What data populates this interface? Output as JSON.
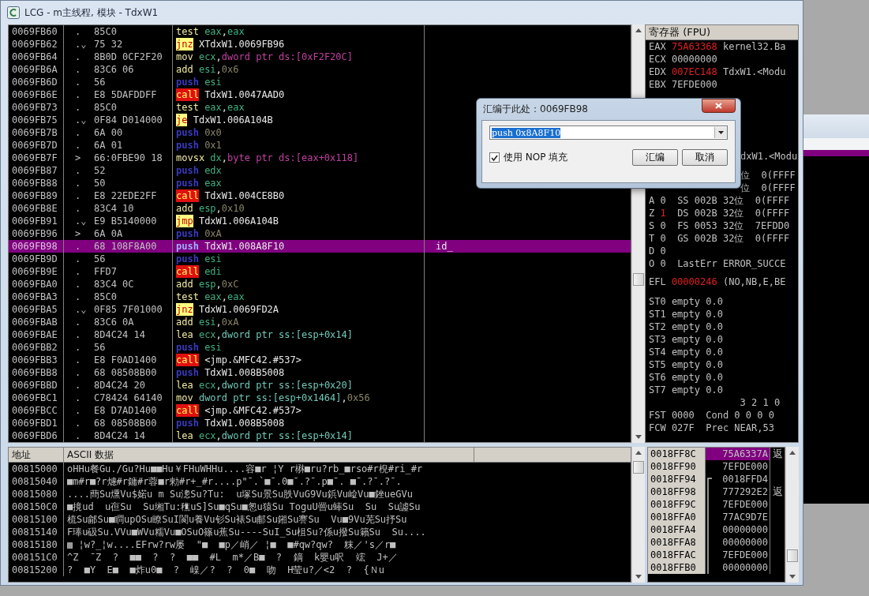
{
  "window": {
    "title": "LCG - m主线程, 模块 - TdxW1"
  },
  "disassembly": {
    "rows": [
      {
        "address": "0069FB60",
        "mark": ".",
        "hex": "85C0",
        "mnemonic": "test",
        "kind": "plain",
        "operands": [
          {
            "text": "eax",
            "kind": "reg"
          },
          {
            "text": ",",
            "kind": "punct"
          },
          {
            "text": "eax",
            "kind": "reg"
          }
        ],
        "selected": false
      },
      {
        "address": "0069FB62",
        "mark": ".⌄",
        "hex": "75 32",
        "mnemonic": "jnz",
        "kind": "jump",
        "operands": [
          {
            "text": "XTdxW1.0069FB96",
            "kind": "label"
          }
        ],
        "selected": false
      },
      {
        "address": "0069FB64",
        "mark": ".",
        "hex": "8B0D 0CF2F20",
        "mnemonic": "mov",
        "kind": "plain",
        "operands": [
          {
            "text": "ecx",
            "kind": "reg"
          },
          {
            "text": ",",
            "kind": "punct"
          },
          {
            "text": "dword ptr ds:[0xF2F20C]",
            "kind": "mem"
          }
        ],
        "selected": false
      },
      {
        "address": "0069FB6A",
        "mark": ".",
        "hex": "83C6 06",
        "mnemonic": "add",
        "kind": "plain",
        "operands": [
          {
            "text": "esi",
            "kind": "reg"
          },
          {
            "text": ",",
            "kind": "punct"
          },
          {
            "text": "0x6",
            "kind": "const"
          }
        ],
        "selected": false
      },
      {
        "address": "0069FB6D",
        "mark": ".",
        "hex": "56",
        "mnemonic": "push",
        "kind": "push",
        "operands": [
          {
            "text": "esi",
            "kind": "reg"
          }
        ],
        "selected": false
      },
      {
        "address": "0069FB6E",
        "mark": ".",
        "hex": "E8 5DAFDDFF",
        "mnemonic": "call",
        "kind": "call",
        "operands": [
          {
            "text": "TdxW1.0047AAD0",
            "kind": "label"
          }
        ],
        "selected": false
      },
      {
        "address": "0069FB73",
        "mark": ".",
        "hex": "85C0",
        "mnemonic": "test",
        "kind": "plain",
        "operands": [
          {
            "text": "eax",
            "kind": "reg"
          },
          {
            "text": ",",
            "kind": "punct"
          },
          {
            "text": "eax",
            "kind": "reg"
          }
        ],
        "selected": false
      },
      {
        "address": "0069FB75",
        "mark": ".⌄",
        "hex": "0F84 D014000",
        "mnemonic": "je",
        "kind": "jump",
        "operands": [
          {
            "text": "TdxW1.006A104B",
            "kind": "label"
          }
        ],
        "selected": false
      },
      {
        "address": "0069FB7B",
        "mark": ".",
        "hex": "6A 00",
        "mnemonic": "push",
        "kind": "push",
        "operands": [
          {
            "text": "0x0",
            "kind": "const"
          }
        ],
        "selected": false
      },
      {
        "address": "0069FB7D",
        "mark": ".",
        "hex": "6A 01",
        "mnemonic": "push",
        "kind": "push",
        "operands": [
          {
            "text": "0x1",
            "kind": "const"
          }
        ],
        "selected": false
      },
      {
        "address": "0069FB7F",
        "mark": ">",
        "hex": "66:0FBE90 18",
        "mnemonic": "movsx",
        "kind": "plain",
        "operands": [
          {
            "text": "dx",
            "kind": "reg"
          },
          {
            "text": ",",
            "kind": "punct"
          },
          {
            "text": "byte ptr ds:[eax+0x118]",
            "kind": "mem"
          }
        ],
        "selected": false
      },
      {
        "address": "0069FB87",
        "mark": ".",
        "hex": "52",
        "mnemonic": "push",
        "kind": "push",
        "operands": [
          {
            "text": "edx",
            "kind": "reg"
          }
        ],
        "selected": false
      },
      {
        "address": "0069FB88",
        "mark": ".",
        "hex": "50",
        "mnemonic": "push",
        "kind": "push",
        "operands": [
          {
            "text": "eax",
            "kind": "reg"
          }
        ],
        "selected": false
      },
      {
        "address": "0069FB89",
        "mark": ".",
        "hex": "E8 22EDE2FF",
        "mnemonic": "call",
        "kind": "call",
        "operands": [
          {
            "text": "TdxW1.004CE8B0",
            "kind": "label"
          }
        ],
        "selected": false
      },
      {
        "address": "0069FB8E",
        "mark": ".",
        "hex": "83C4 10",
        "mnemonic": "add",
        "kind": "plain",
        "operands": [
          {
            "text": "esp",
            "kind": "reg"
          },
          {
            "text": ",",
            "kind": "punct"
          },
          {
            "text": "0x10",
            "kind": "const"
          }
        ],
        "selected": false
      },
      {
        "address": "0069FB91",
        "mark": ".⌄",
        "hex": "E9 B5140000",
        "mnemonic": "jmp",
        "kind": "jump",
        "operands": [
          {
            "text": "TdxW1.006A104B",
            "kind": "label"
          }
        ],
        "selected": false
      },
      {
        "address": "0069FB96",
        "mark": ">",
        "hex": "6A 0A",
        "mnemonic": "push",
        "kind": "push",
        "operands": [
          {
            "text": "0xA",
            "kind": "const"
          }
        ],
        "selected": false
      },
      {
        "address": "0069FB98",
        "mark": ".",
        "hex": "68 108F8A00",
        "mnemonic": "push",
        "kind": "push",
        "operands": [
          {
            "text": "TdxW1.008A8F10",
            "kind": "label"
          }
        ],
        "comment": "id_",
        "selected": true
      },
      {
        "address": "0069FB9D",
        "mark": ".",
        "hex": "56",
        "mnemonic": "push",
        "kind": "push",
        "operands": [
          {
            "text": "esi",
            "kind": "reg"
          }
        ],
        "selected": false
      },
      {
        "address": "0069FB9E",
        "mark": ".",
        "hex": "FFD7",
        "mnemonic": "call",
        "kind": "call",
        "operands": [
          {
            "text": "edi",
            "kind": "reg"
          }
        ],
        "selected": false
      },
      {
        "address": "0069FBA0",
        "mark": ".",
        "hex": "83C4 0C",
        "mnemonic": "add",
        "kind": "plain",
        "operands": [
          {
            "text": "esp",
            "kind": "reg"
          },
          {
            "text": ",",
            "kind": "punct"
          },
          {
            "text": "0xC",
            "kind": "const"
          }
        ],
        "selected": false
      },
      {
        "address": "0069FBA3",
        "mark": ".",
        "hex": "85C0",
        "mnemonic": "test",
        "kind": "plain",
        "operands": [
          {
            "text": "eax",
            "kind": "reg"
          },
          {
            "text": ",",
            "kind": "punct"
          },
          {
            "text": "eax",
            "kind": "reg"
          }
        ],
        "selected": false
      },
      {
        "address": "0069FBA5",
        "mark": ".⌄",
        "hex": "0F85 7F01000",
        "mnemonic": "jnz",
        "kind": "jump",
        "operands": [
          {
            "text": "TdxW1.0069FD2A",
            "kind": "label"
          }
        ],
        "selected": false
      },
      {
        "address": "0069FBAB",
        "mark": ".",
        "hex": "83C6 0A",
        "mnemonic": "add",
        "kind": "plain",
        "operands": [
          {
            "text": "esi",
            "kind": "reg"
          },
          {
            "text": ",",
            "kind": "punct"
          },
          {
            "text": "0xA",
            "kind": "const"
          }
        ],
        "selected": false
      },
      {
        "address": "0069FBAE",
        "mark": ".",
        "hex": "8D4C24 14",
        "mnemonic": "lea",
        "kind": "plain",
        "operands": [
          {
            "text": "ecx",
            "kind": "reg"
          },
          {
            "text": ",",
            "kind": "punct"
          },
          {
            "text": "dword ptr ss:[esp+0x14]",
            "kind": "stack"
          }
        ],
        "selected": false
      },
      {
        "address": "0069FBB2",
        "mark": ".",
        "hex": "56",
        "mnemonic": "push",
        "kind": "push",
        "operands": [
          {
            "text": "esi",
            "kind": "reg"
          }
        ],
        "selected": false
      },
      {
        "address": "0069FBB3",
        "mark": ".",
        "hex": "E8 F0AD1400",
        "mnemonic": "call",
        "kind": "call",
        "operands": [
          {
            "text": "<jmp.&MFC42.#537>",
            "kind": "label"
          }
        ],
        "selected": false
      },
      {
        "address": "0069FBB8",
        "mark": ".",
        "hex": "68 08508B00",
        "mnemonic": "push",
        "kind": "push",
        "operands": [
          {
            "text": "TdxW1.008B5008",
            "kind": "label"
          }
        ],
        "selected": false
      },
      {
        "address": "0069FBBD",
        "mark": ".",
        "hex": "8D4C24 20",
        "mnemonic": "lea",
        "kind": "plain",
        "operands": [
          {
            "text": "ecx",
            "kind": "reg"
          },
          {
            "text": ",",
            "kind": "punct"
          },
          {
            "text": "dword ptr ss:[esp+0x20]",
            "kind": "stack"
          }
        ],
        "selected": false
      },
      {
        "address": "0069FBC1",
        "mark": ".",
        "hex": "C78424 64140",
        "mnemonic": "mov",
        "kind": "plain",
        "operands": [
          {
            "text": "dword ptr ss:[esp+0x1464]",
            "kind": "stack"
          },
          {
            "text": ",",
            "kind": "punct"
          },
          {
            "text": "0x56",
            "kind": "const"
          }
        ],
        "selected": false
      },
      {
        "address": "0069FBCC",
        "mark": ".",
        "hex": "E8 D7AD1400",
        "mnemonic": "call",
        "kind": "call",
        "operands": [
          {
            "text": "<jmp.&MFC42.#537>",
            "kind": "label"
          }
        ],
        "selected": false
      },
      {
        "address": "0069FBD1",
        "mark": ".",
        "hex": "68 08508B00",
        "mnemonic": "push",
        "kind": "push",
        "operands": [
          {
            "text": "TdxW1.008B5008",
            "kind": "label"
          }
        ],
        "selected": false
      },
      {
        "address": "0069FBD6",
        "mark": ".",
        "hex": "8D4C24 14",
        "mnemonic": "lea",
        "kind": "plain",
        "operands": [
          {
            "text": "ecx",
            "kind": "reg"
          },
          {
            "text": ",",
            "kind": "punct"
          },
          {
            "text": "dword ptr ss:[esp+0x14]",
            "kind": "stack"
          }
        ],
        "selected": false
      }
    ]
  },
  "registers": {
    "title": "寄存器 (FPU)",
    "groups": [
      {
        "lines": [
          {
            "kind": "reg",
            "name": "EAX",
            "value": "75A63368",
            "changed": true,
            "comment": "kernel32.Ba"
          },
          {
            "kind": "reg",
            "name": "ECX",
            "value": "00000000",
            "changed": false
          },
          {
            "kind": "reg",
            "name": "EDX",
            "value": "007EC148",
            "changed": true,
            "comment": "TdxW1.<Modu"
          },
          {
            "kind": "reg",
            "name": "EBX",
            "value": "7EFDE000",
            "changed": false
          }
        ]
      },
      {
        "lines": [
          {
            "kind": "partial",
            "text": "dxW1.<Modu"
          }
        ]
      },
      {
        "lines": [
          {
            "kind": "partial",
            "text": "位  0(FFFF"
          },
          {
            "kind": "partial",
            "text": "位  0(FFFF"
          },
          {
            "kind": "flag",
            "flag": "A",
            "value": "0",
            "changed": false,
            "rest": "SS 002B 32位  0(FFFF"
          },
          {
            "kind": "flag",
            "flag": "Z",
            "value": "1",
            "changed": true,
            "rest": "DS 002B 32位  0(FFFF"
          },
          {
            "kind": "flag",
            "flag": "S",
            "value": "0",
            "changed": false,
            "rest": "FS 0053 32位  7EFDD0"
          },
          {
            "kind": "flag",
            "flag": "T",
            "value": "0",
            "changed": false,
            "rest": "GS 002B 32位  0(FFFF"
          },
          {
            "kind": "flag",
            "flag": "D",
            "value": "0",
            "changed": false
          },
          {
            "kind": "flag",
            "flag": "O",
            "value": "0",
            "changed": false,
            "rest": "LastErr ERROR_SUCCE"
          }
        ]
      },
      {
        "lines": [
          {
            "kind": "reg",
            "name": "EFL",
            "value": "00000246",
            "changed": true,
            "comment": "(NO,NB,E,BE"
          }
        ]
      },
      {
        "lines": [
          {
            "kind": "text",
            "text": "ST0 empty 0.0"
          },
          {
            "kind": "text",
            "text": "ST1 empty 0.0"
          },
          {
            "kind": "text",
            "text": "ST2 empty 0.0"
          },
          {
            "kind": "text",
            "text": "ST3 empty 0.0"
          },
          {
            "kind": "text",
            "text": "ST4 empty 0.0"
          },
          {
            "kind": "text",
            "text": "ST5 empty 0.0"
          },
          {
            "kind": "text",
            "text": "ST6 empty 0.0"
          },
          {
            "kind": "text",
            "text": "ST7 empty 0.0"
          },
          {
            "kind": "text",
            "text": "                3 2 1 0"
          },
          {
            "kind": "text",
            "text": "FST 0000  Cond 0 0 0 0"
          },
          {
            "kind": "text",
            "text": "FCW 027F  Prec NEAR,53"
          }
        ]
      }
    ]
  },
  "dump": {
    "columns": [
      "地址",
      "ASCII 数据"
    ],
    "rows": [
      {
        "address": "00815000",
        "ascii": "oHHu餐Gu./Gu?Hu■■Hu￥FHuWHHu....容■r ¦Y r楙■ru?rb_■rso#r棿#ri_#r"
      },
      {
        "address": "00815040",
        "ascii": "■m#r■?r爈#r鏞#r蓉■r勑#r+_#r....p\"¯.`■¯.0■¯.?¯.p■¯. ■¯.?¯.?¯."
      },
      {
        "address": "00815080",
        "ascii": "....蔄Su燻Vu$婼u m Su漗Su?Tu:  u塚Su景Su胅VuG9Vu鋲Vu崄Vu■銼ueGVu"
      },
      {
        "address": "008150C0",
        "ascii": "■摬ud  u亱Su  Su缃Tu:穛uS]Su■qSu■怱u猿Su ToguU罾u蜯Su  Su  Su譃Su"
      },
      {
        "address": "00815100",
        "ascii": "梳Su鄃Su■瞷upOSu瞭SuI閬u養Vu钐Su裱Su郙Su鎺Su謇Su  Vu■9Vu芜Su抒Su"
      },
      {
        "address": "00815140",
        "ascii": "F琫u砐Su.VVu■WVu糯Vu■OSuO篠u蕉Su----SuI_Su柤Su?係u撥Su籟Su  Su...."
      },
      {
        "address": "00815180",
        "ascii": "▩ ¦w?_¦w....EFrw?rw屡  \"■  ■p／峭／ ¦■  ■#qw?qw?  粖／'s／r■"
      },
      {
        "address": "008151C0",
        "ascii": "^Z  ¯Z  ?  ■■  ?  ?  ■■  #L  m*／B■  ?  鏑  k嬰u呎  竤  J+／"
      },
      {
        "address": "00815200",
        "ascii": "?  ■Y  E■  ■炸u0■  ?  嵲／?  ?  0■  吻  H莹u?／<2  ?  {Ｎu"
      }
    ]
  },
  "stack": {
    "rows": [
      {
        "address": "0018FF8C",
        "value": "75A6337A",
        "comment": "返",
        "selected": true
      },
      {
        "address": "0018FF90",
        "value": "7EFDE000",
        "selected": false
      },
      {
        "address": "0018FF94",
        "value": "0018FFD4",
        "selected": false
      },
      {
        "address": "0018FF98",
        "value": "777292E2",
        "comment": "返",
        "selected": false
      },
      {
        "address": "0018FF9C",
        "value": "7EFDE000",
        "selected": false
      },
      {
        "address": "0018FFA0",
        "value": "77AC9D7E",
        "selected": false
      },
      {
        "address": "0018FFA4",
        "value": "00000000",
        "selected": false
      },
      {
        "address": "0018FFA8",
        "value": "00000000",
        "selected": false
      },
      {
        "address": "0018FFAC",
        "value": "7EFDE000",
        "selected": false
      },
      {
        "address": "0018FFB0",
        "value": "00000000",
        "selected": false
      }
    ]
  },
  "dialog": {
    "title": "汇编于此处：0069FB98",
    "input": {
      "value": "push 0x8A8F10"
    },
    "checkbox": {
      "label": "使用 NOP 填充",
      "checked": true
    },
    "buttons": [
      "汇编",
      "取消"
    ]
  }
}
